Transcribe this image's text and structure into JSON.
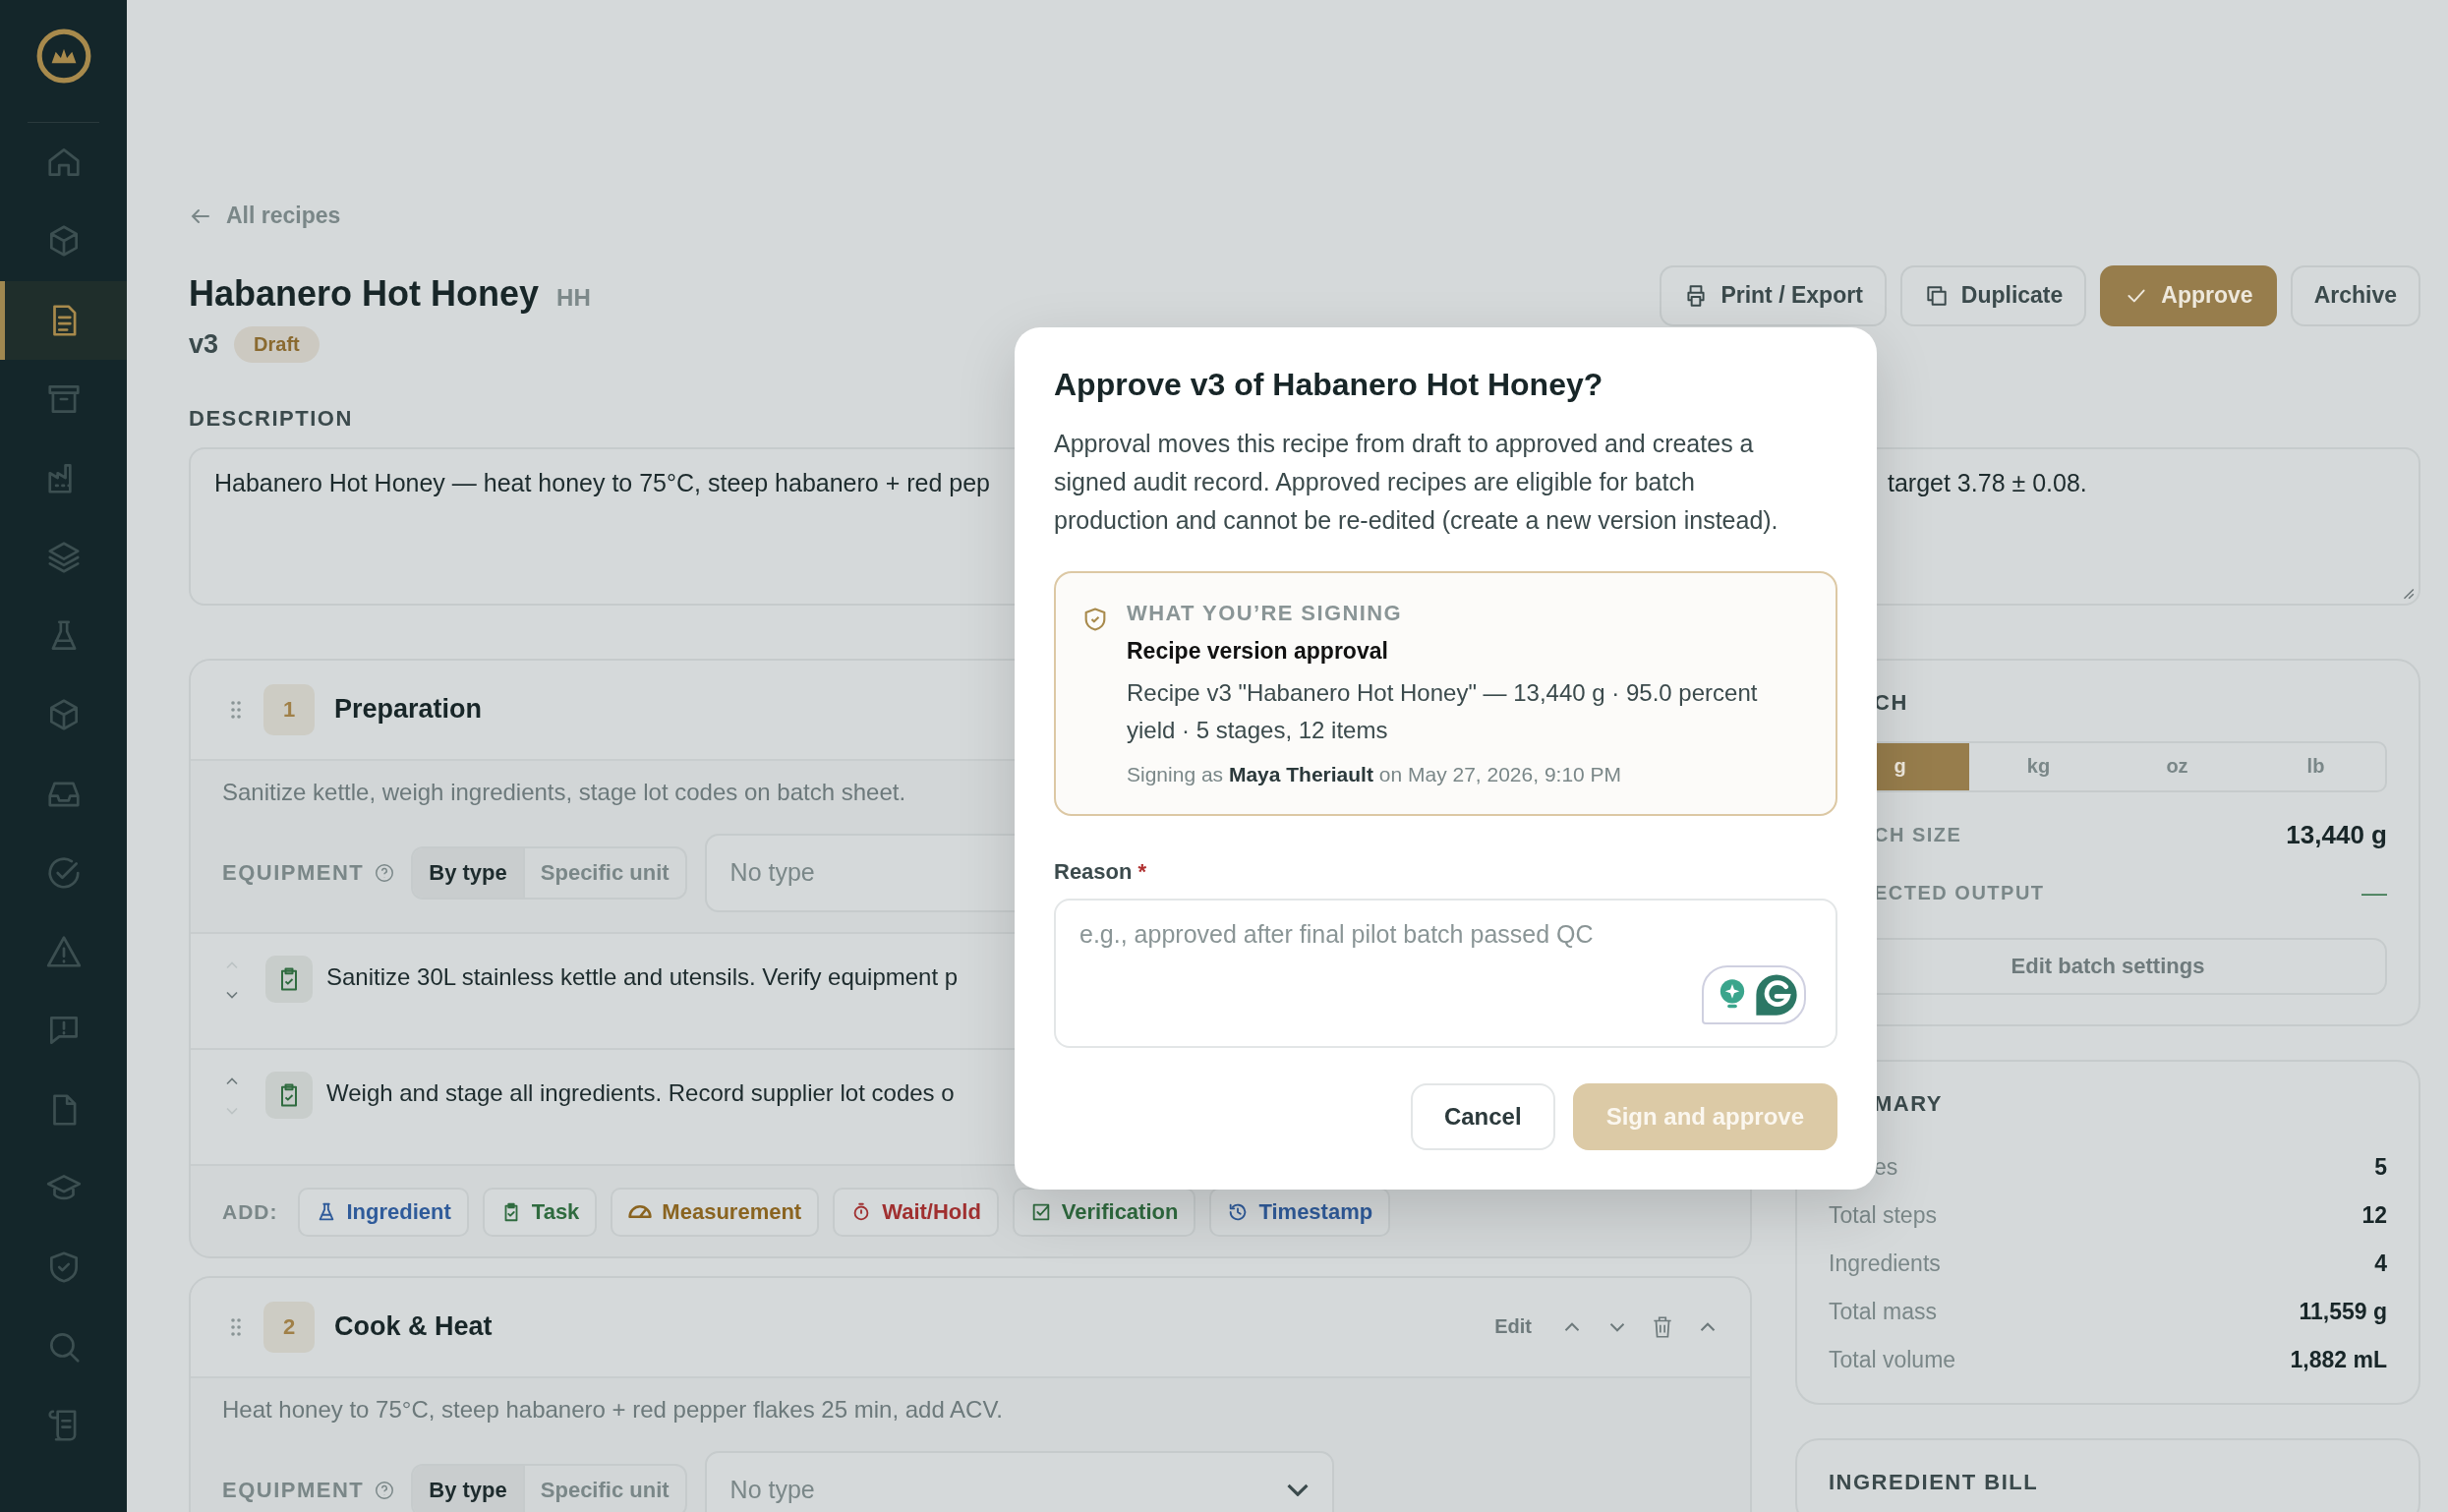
{
  "sidebar": {
    "items": [
      {
        "selected": false
      },
      {
        "selected": false
      },
      {
        "selected": true
      },
      {
        "selected": false
      },
      {
        "selected": false
      },
      {
        "selected": false
      },
      {
        "selected": false
      },
      {
        "selected": false
      },
      {
        "selected": false
      },
      {
        "selected": false
      },
      {
        "selected": false
      },
      {
        "selected": false
      },
      {
        "selected": false
      },
      {
        "selected": false
      },
      {
        "selected": false
      },
      {
        "selected": false
      },
      {
        "selected": false
      }
    ]
  },
  "back_link": {
    "label": "All recipes"
  },
  "recipe": {
    "title": "Habanero Hot Honey",
    "code": "HH",
    "version": "v3",
    "status": "Draft"
  },
  "actions": [
    {
      "label": "Print / Export",
      "kind": "print",
      "primary": false
    },
    {
      "label": "Duplicate",
      "kind": "duplicate",
      "primary": false
    },
    {
      "label": "Approve",
      "kind": "approve",
      "primary": true
    },
    {
      "label": "Archive",
      "kind": "plain",
      "primary": false
    }
  ],
  "description": {
    "label": "DESCRIPTION",
    "text_left": "Habanero Hot Honey — heat honey to 75°C, steep habanero + red pep",
    "text_right": "target 3.78 ± 0.08."
  },
  "stages": [
    {
      "number": "1",
      "title": "Preparation",
      "description": "Sanitize kettle, weigh ingredients, stage lot codes on batch sheet.",
      "equipment": {
        "label": "EQUIPMENT",
        "modes": [
          {
            "label": "By type",
            "selected": true
          },
          {
            "label": "Specific unit",
            "selected": false
          }
        ],
        "placeholder": "No type",
        "chevron": false
      },
      "steps": [
        {
          "text": "Sanitize 30L stainless kettle and utensils. Verify equipment p",
          "up_disabled": true,
          "down_disabled": false
        },
        {
          "text": "Weigh and stage all ingredients. Record supplier lot codes o",
          "up_disabled": false,
          "down_disabled": true
        }
      ],
      "add": {
        "label": "ADD:",
        "items": [
          {
            "label": "Ingredient",
            "kind": "ingredient",
            "color": "#2f5b9a"
          },
          {
            "label": "Task",
            "kind": "task",
            "color": "#2f6b3f"
          },
          {
            "label": "Measurement",
            "kind": "measurement",
            "color": "#8a6420"
          },
          {
            "label": "Wait/Hold",
            "kind": "wait",
            "color": "#a03030"
          },
          {
            "label": "Verification",
            "kind": "verification",
            "color": "#2f6b3f"
          },
          {
            "label": "Timestamp",
            "kind": "timestamp",
            "color": "#2f5b9a"
          }
        ]
      }
    },
    {
      "number": "2",
      "title": "Cook & Heat",
      "edit_label": "Edit",
      "description": "Heat honey to 75°C, steep habanero + red pepper flakes 25 min, add ACV.",
      "equipment": {
        "label": "EQUIPMENT",
        "modes": [
          {
            "label": "By type",
            "selected": true
          },
          {
            "label": "Specific unit",
            "selected": false
          }
        ],
        "placeholder": "No type",
        "chevron": true
      }
    }
  ],
  "batch": {
    "title": "CH",
    "units": [
      {
        "label": "g",
        "selected": true
      },
      {
        "label": "kg",
        "selected": false
      },
      {
        "label": "oz",
        "selected": false
      },
      {
        "label": "lb",
        "selected": false
      }
    ],
    "rows": [
      {
        "label": "CH SIZE",
        "value": "13,440 g",
        "kind": "value"
      },
      {
        "label": "ECTED OUTPUT",
        "value": "—",
        "kind": "empty"
      }
    ],
    "button": "Edit batch settings"
  },
  "summary": {
    "title": "MARY",
    "rows": [
      {
        "label": "es",
        "value": "5"
      },
      {
        "label": "Total steps",
        "value": "12"
      },
      {
        "label": "Ingredients",
        "value": "4"
      },
      {
        "label": "Total mass",
        "value": "11,559 g"
      },
      {
        "label": "Total volume",
        "value": "1,882 mL"
      }
    ]
  },
  "ingredient_bill": {
    "title": "INGREDIENT BILL"
  },
  "modal": {
    "title": "Approve v3 of Habanero Hot Honey?",
    "body": "Approval moves this recipe from draft to approved and creates a signed audit record. Approved recipes are eligible for batch production and cannot be re-edited (create a new version instead).",
    "signing": {
      "label": "WHAT YOU’RE SIGNING",
      "title": "Recipe version approval",
      "details": "Recipe v3 \"Habanero Hot Honey\" — 13,440 g · 95.0 percent yield · 5 stages, 12 items",
      "signer": "Signing as **Maya Theriault** on May 27, 2026, 9:10 PM"
    },
    "reason": {
      "label": "Reason",
      "required_mark": "*",
      "placeholder": "e.g., approved after final pilot batch passed QC"
    },
    "buttons": [
      {
        "label": "Cancel",
        "primary": false,
        "disabled": false
      },
      {
        "label": "Sign and approve",
        "primary": true,
        "disabled": true
      }
    ]
  }
}
